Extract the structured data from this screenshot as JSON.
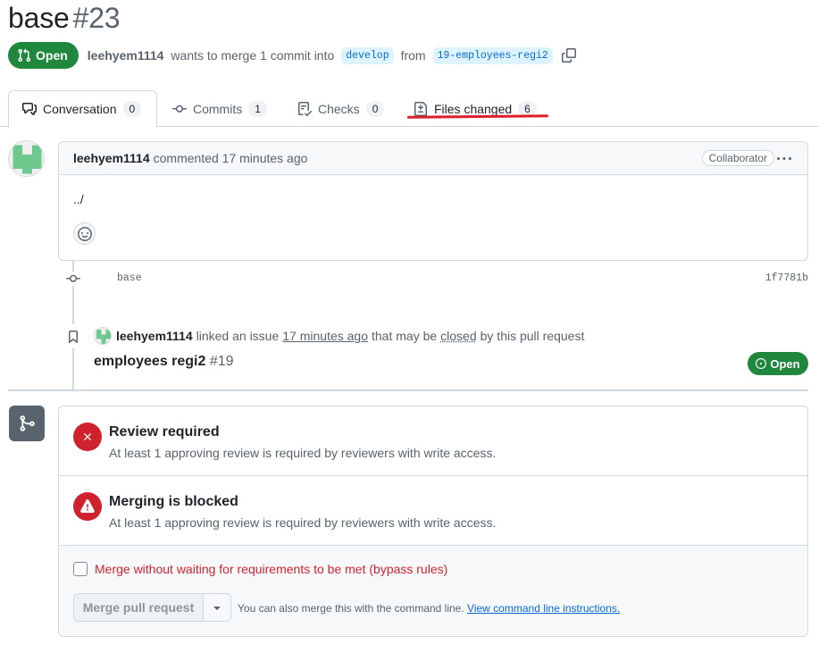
{
  "pr": {
    "title": "base",
    "number": "#23",
    "state": "Open",
    "author": "leehyem1114",
    "merge_text": "wants to merge 1 commit into",
    "base_branch": "develop",
    "from_text": "from",
    "head_branch": "19-employees-regi2"
  },
  "tabs": [
    {
      "label": "Conversation",
      "count": "0"
    },
    {
      "label": "Commits",
      "count": "1"
    },
    {
      "label": "Checks",
      "count": "0"
    },
    {
      "label": "Files changed",
      "count": "6"
    }
  ],
  "comment": {
    "author": "leehyem1114",
    "action": "commented 17 minutes ago",
    "role": "Collaborator",
    "body": "../"
  },
  "commit": {
    "message": "base",
    "sha": "1f7781b"
  },
  "linked_event": {
    "author": "leehyem1114",
    "text1": "linked an issue",
    "time": "17 minutes ago",
    "text2": "that may be",
    "closed_word": "closed",
    "text3": "by this pull request",
    "issue_title": "employees regi2",
    "issue_number": "#19",
    "issue_state": "Open"
  },
  "merge": {
    "review_title": "Review required",
    "review_sub": "At least 1 approving review is required by reviewers with write access.",
    "blocked_title": "Merging is blocked",
    "blocked_sub": "At least 1 approving review is required by reviewers with write access.",
    "bypass_label": "Merge without waiting for requirements to be met (bypass rules)",
    "button_label": "Merge pull request",
    "cli_text": "You can also merge this with the command line.",
    "cli_link": "View command line instructions."
  },
  "colors": {
    "open_green": "#1f883d",
    "blocked_red": "#cf222e",
    "annotation_red": "#dc1f2a",
    "link_blue": "#0969da"
  }
}
